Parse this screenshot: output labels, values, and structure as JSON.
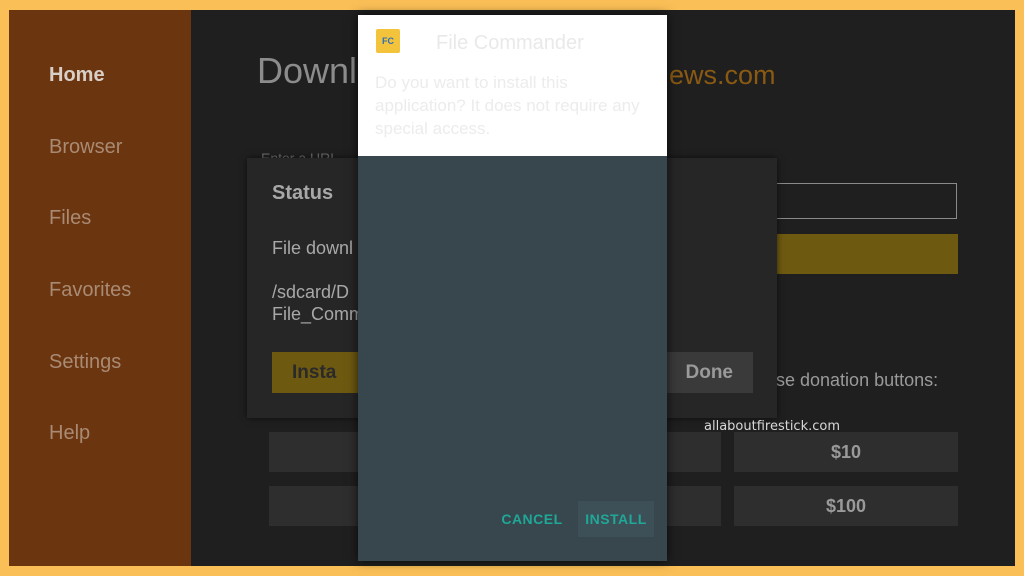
{
  "sidebar": {
    "items": [
      {
        "label": "Home",
        "active": true
      },
      {
        "label": "Browser",
        "active": false
      },
      {
        "label": "Files",
        "active": false
      },
      {
        "label": "Favorites",
        "active": false
      },
      {
        "label": "Settings",
        "active": false
      },
      {
        "label": "Help",
        "active": false
      }
    ]
  },
  "main": {
    "title_fragment": "Downl",
    "brand_fragment": "ews.com",
    "url_label_fragment": "Enter a URL",
    "donation_label": "se donation buttons:",
    "donation_buttons": [
      "$10",
      "$100"
    ]
  },
  "status_dialog": {
    "title": "Status",
    "line1": "File downl",
    "line2": "/sdcard/D",
    "line3": "File_Comm",
    "install_label": "Insta",
    "done_label": "Done"
  },
  "watermark": "allaboutfirestick.com",
  "installer": {
    "icon_text": "FC",
    "app_name": "File Commander",
    "question": "Do you want to install this application? It does not require any special access.",
    "cancel_label": "CANCEL",
    "install_label": "INSTALL"
  },
  "colors": {
    "border": "#fbbf57",
    "sidebar": "#6b3510",
    "accent": "#1fa797",
    "installer_bg": "#37474d"
  }
}
